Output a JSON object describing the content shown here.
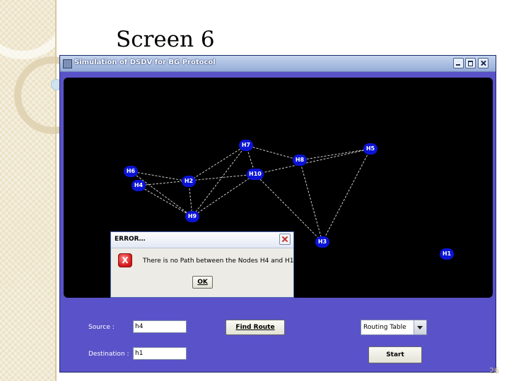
{
  "slide": {
    "title": "Screen 6",
    "page_number": "26"
  },
  "window": {
    "title": "Simulation of DSDV for BG Protocol"
  },
  "network": {
    "nodes": [
      {
        "id": "H7",
        "label": "H7"
      },
      {
        "id": "H5",
        "label": "H5"
      },
      {
        "id": "H8",
        "label": "H8"
      },
      {
        "id": "H6",
        "label": "H6"
      },
      {
        "id": "H10",
        "label": "H10"
      },
      {
        "id": "H4",
        "label": "H4"
      },
      {
        "id": "H2",
        "label": "H2"
      },
      {
        "id": "H9",
        "label": "H9"
      },
      {
        "id": "H3",
        "label": "H3"
      },
      {
        "id": "H1",
        "label": "H1"
      }
    ],
    "links": [
      [
        "H7",
        "H8"
      ],
      [
        "H7",
        "H2"
      ],
      [
        "H7",
        "H9"
      ],
      [
        "H7",
        "H10"
      ],
      [
        "H8",
        "H5"
      ],
      [
        "H8",
        "H3"
      ],
      [
        "H5",
        "H10"
      ],
      [
        "H5",
        "H3"
      ],
      [
        "H6",
        "H2"
      ],
      [
        "H6",
        "H9"
      ],
      [
        "H4",
        "H10"
      ],
      [
        "H4",
        "H9"
      ],
      [
        "H2",
        "H9"
      ],
      [
        "H10",
        "H9"
      ],
      [
        "H10",
        "H3"
      ]
    ]
  },
  "form": {
    "source_label": "Source :",
    "source_value": "h4",
    "destination_label": "Destination :",
    "destination_value": "h1",
    "find_route_label": "Find Route",
    "routing_table_value": "Routing Table",
    "start_label": "Start"
  },
  "dialog": {
    "title": "ERROR…",
    "message": "There is no Path between the Nodes H4 and H1",
    "ok_label": "OK"
  },
  "colors": {
    "node_fill": "#0b14d6",
    "link_stroke": "#ffffff",
    "window_body": "#5a52c8",
    "canvas": "#000000"
  }
}
